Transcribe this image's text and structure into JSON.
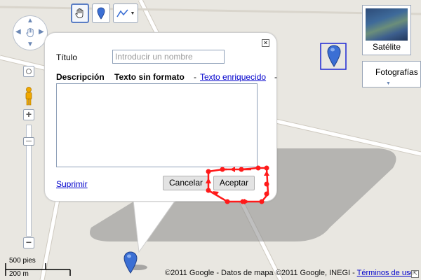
{
  "toolbar": {
    "hand_tool": "hand-icon",
    "marker_tool": "marker-icon",
    "line_tool": "polyline-icon",
    "dropdown": "chevron-down-icon"
  },
  "map_type": {
    "satellite_label": "Satélite",
    "photos_label": "Fotografías",
    "expand": "chevron-down-icon"
  },
  "info_window": {
    "title_label": "Título",
    "title_placeholder": "Introducir un nombre",
    "description_label": "Descripción",
    "plain_text": "Texto sin formato",
    "separator": "-",
    "rich_text": "Texto enriquecido",
    "separator2": "-",
    "delete_link": "Suprimir",
    "cancel_button": "Cancelar",
    "accept_button": "Aceptar",
    "close": "close-icon"
  },
  "scale": {
    "feet": "500 pies",
    "meters": "200 m"
  },
  "footer": {
    "copyright": "©2011 Google - Datos de mapa ©2011 Google, INEGI - ",
    "terms_link": "Términos de uso"
  },
  "colors": {
    "map_bg": "#e9e7e1",
    "road": "#ffffff",
    "marker": "#3b6fd4",
    "highlight": "#ff0000",
    "link": "#0000cc"
  }
}
